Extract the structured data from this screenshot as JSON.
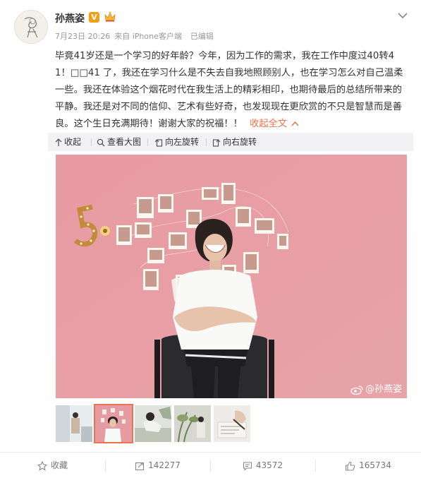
{
  "header": {
    "username": "孙燕姿",
    "verified_badge": "V",
    "date": "7月23日 20:26",
    "source": "来自 iPhone客户端",
    "edited": "已编辑"
  },
  "post": {
    "text": "毕竟41岁还是一个学习的好年龄？今年，因为工作的需求，我在工作中度过40转41！□□41 了，我还在学习什么是不失去自我地照顾别人，也在学习怎么对自己温柔一些。我还在体验这个烟花时代在我生活上的精彩相印，也期待最后的总结所带来的平静。我还是对不同的信仰、艺术有些好奇，也发现现在更欣赏的不只是智慧而是善良。这个生日充满期待！谢谢大家的祝福！！",
    "collapse_label": "收起全文"
  },
  "toolbar": {
    "collapse": "收起",
    "view_large": "查看大图",
    "rotate_left": "向左旋转",
    "rotate_right": "向右旋转"
  },
  "photo": {
    "watermark": "@孙燕姿"
  },
  "footer": {
    "favorite": "收藏",
    "reposts": "142277",
    "comments": "43572",
    "likes": "165734"
  },
  "colors": {
    "accent": "#eb7350",
    "wall_pink": "#e9a0a6",
    "toolbar_bg": "#f2f2f5"
  }
}
